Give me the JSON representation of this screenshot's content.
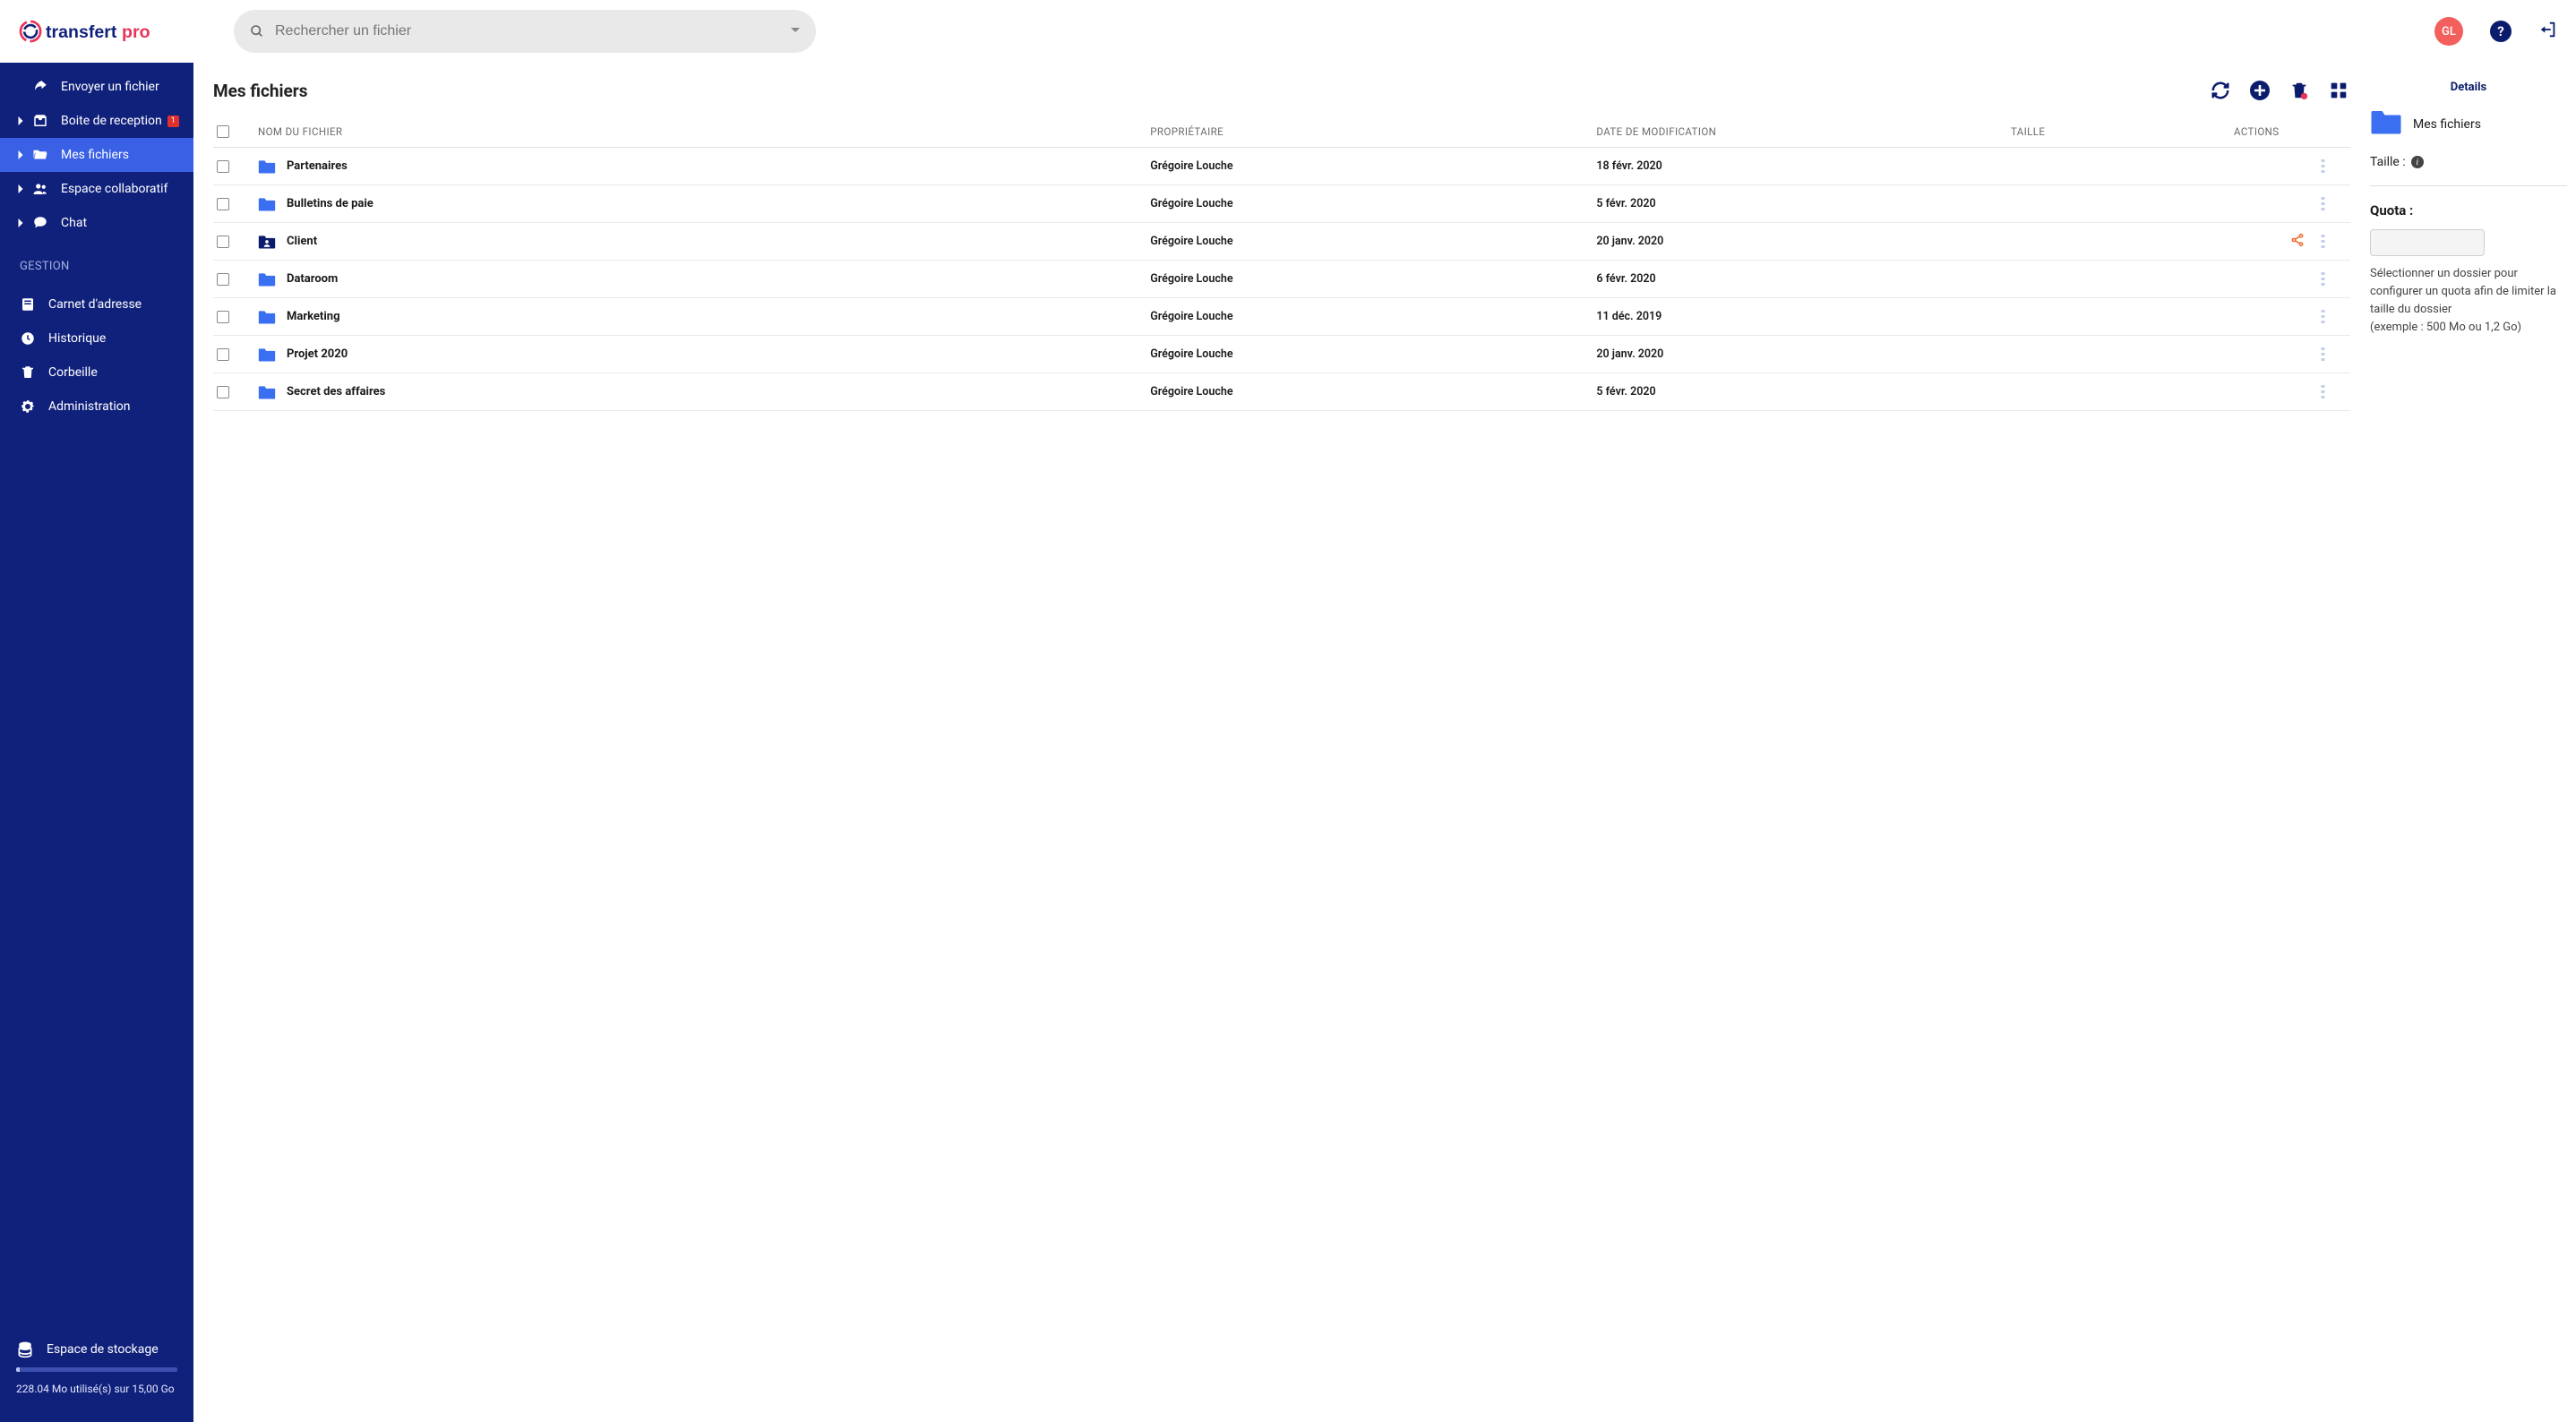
{
  "brand": {
    "name1": "transfert",
    "name2": "pro"
  },
  "search": {
    "placeholder": "Rechercher un fichier"
  },
  "user": {
    "initials": "GL"
  },
  "sidebar": {
    "nav": [
      {
        "label": "Envoyer un fichier",
        "icon": "share",
        "chevron": false
      },
      {
        "label": "Boite de reception",
        "icon": "inbox",
        "chevron": true,
        "badge": "1"
      },
      {
        "label": "Mes fichiers",
        "icon": "folder-open",
        "chevron": true,
        "active": true
      },
      {
        "label": "Espace collaboratif",
        "icon": "users",
        "chevron": true
      },
      {
        "label": "Chat",
        "icon": "chat",
        "chevron": true
      }
    ],
    "gestion_label": "GESTION",
    "gestion": [
      {
        "label": "Carnet d'adresse",
        "icon": "book"
      },
      {
        "label": "Historique",
        "icon": "clock"
      },
      {
        "label": "Corbeille",
        "icon": "trash"
      },
      {
        "label": "Administration",
        "icon": "gear"
      }
    ],
    "storage": {
      "label": "Espace de stockage",
      "text": "228.04 Mo utilisé(s) sur 15,00 Go"
    }
  },
  "page_title": "Mes fichiers",
  "columns": {
    "name": "NOM DU FICHIER",
    "owner": "PROPRIÉTAIRE",
    "date": "DATE DE MODIFICATION",
    "size": "TAILLE",
    "actions": "ACTIONS"
  },
  "rows": [
    {
      "name": "Partenaires",
      "owner": "Grégoire Louche",
      "date": "18 févr. 2020",
      "shared": false,
      "folderType": "blue"
    },
    {
      "name": "Bulletins de paie",
      "owner": "Grégoire Louche",
      "date": "5 févr. 2020",
      "shared": false,
      "folderType": "blue"
    },
    {
      "name": "Client",
      "owner": "Grégoire Louche",
      "date": "20 janv. 2020",
      "shared": true,
      "folderType": "darkperson"
    },
    {
      "name": "Dataroom",
      "owner": "Grégoire Louche",
      "date": "6 févr. 2020",
      "shared": false,
      "folderType": "blue"
    },
    {
      "name": "Marketing",
      "owner": "Grégoire Louche",
      "date": "11 déc. 2019",
      "shared": false,
      "folderType": "blue"
    },
    {
      "name": "Projet 2020",
      "owner": "Grégoire Louche",
      "date": "20 janv. 2020",
      "shared": false,
      "folderType": "blue"
    },
    {
      "name": "Secret des affaires",
      "owner": "Grégoire Louche",
      "date": "5 févr. 2020",
      "shared": false,
      "folderType": "blue"
    }
  ],
  "details": {
    "header": "Details",
    "folder_label": "Mes fichiers",
    "size_label": "Taille :",
    "quota_label": "Quota :",
    "quota_help": "Sélectionner un dossier pour configurer un quota afin de limiter la taille du dossier",
    "quota_example": "(exemple : 500 Mo ou 1,2 Go)"
  }
}
